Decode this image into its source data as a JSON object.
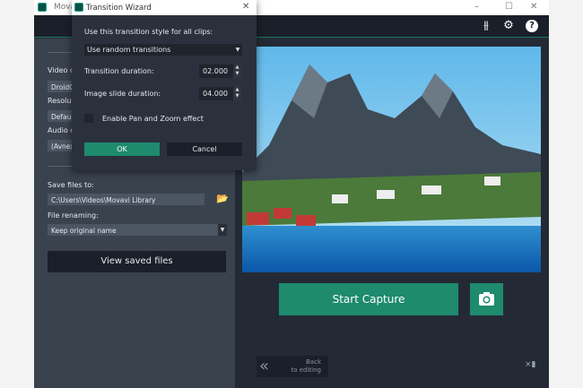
{
  "app": {
    "title": "Movavi",
    "window_controls": [
      "minimize",
      "maximize",
      "close"
    ]
  },
  "toolbar": {
    "icons": [
      "equalizer-icon",
      "gear-icon",
      "help-icon"
    ]
  },
  "left_panel": {
    "video_label": "Video c",
    "video_value": "DroidC",
    "resolution_label": "Resolut",
    "resolution_value": "Defaul",
    "audio_label": "Audio c",
    "audio_value": "(Avnex",
    "save_label": "Save files to:",
    "save_path": "C:\\Users\\Videos\\Movavi Library",
    "rename_label": "File renaming:",
    "rename_value": "Keep original name",
    "view_button": "View saved files"
  },
  "main": {
    "start_capture": "Start Capture",
    "back_line1": "Back",
    "back_line2": "to editing"
  },
  "dialog": {
    "title": "Transition Wizard",
    "style_label": "Use this transition style for all clips:",
    "style_value": "Use random transitions",
    "transition_label": "Transition duration:",
    "transition_value": "02.000",
    "slide_label": "Image slide duration:",
    "slide_value": "04.000",
    "panzoom_label": "Enable Pan and Zoom effect",
    "panzoom_checked": false,
    "ok": "OK",
    "cancel": "Cancel"
  }
}
